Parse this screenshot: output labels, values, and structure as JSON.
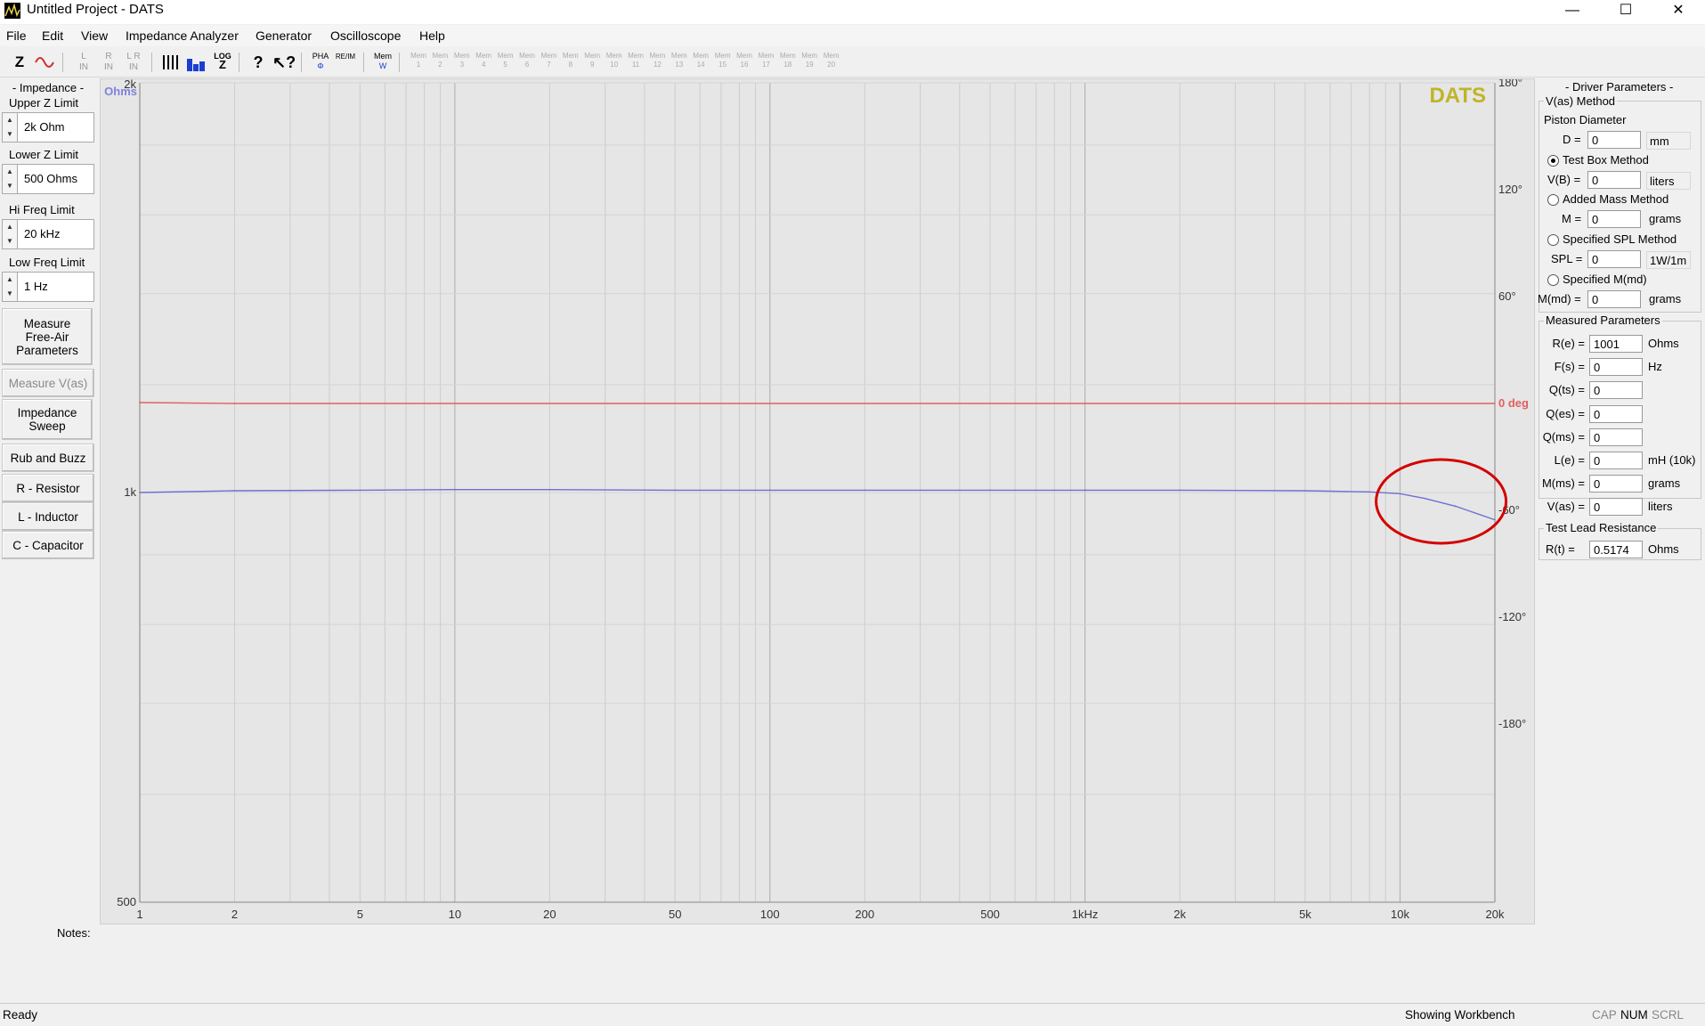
{
  "window": {
    "title": "Untitled Project - DATS",
    "minimize": "—",
    "maximize": "☐",
    "close": "✕"
  },
  "menu": [
    "File",
    "Edit",
    "View",
    "Impedance Analyzer",
    "Generator",
    "Oscilloscope",
    "Help"
  ],
  "toolbar": {
    "z_label": "Z",
    "log_label": "LOG",
    "pha_label": "PHA",
    "re_im_label": "RE/IM",
    "mem_label": "Mem",
    "mem_slots": [
      "1",
      "2",
      "3",
      "4",
      "5",
      "6",
      "7",
      "8",
      "9",
      "10",
      "11",
      "12",
      "13",
      "14",
      "15",
      "16",
      "17",
      "18",
      "19",
      "20"
    ]
  },
  "left_panel": {
    "header": "- Impedance -",
    "upper_z_label": "Upper Z Limit",
    "upper_z_value": "2k Ohm",
    "lower_z_label": "Lower Z Limit",
    "lower_z_value": "500 Ohms",
    "hi_freq_label": "Hi Freq Limit",
    "hi_freq_value": "20 kHz",
    "low_freq_label": "Low Freq Limit",
    "low_freq_value": "1 Hz",
    "buttons": {
      "measure_free_air": "Measure Free-Air Parameters",
      "measure_vas": "Measure V(as)",
      "impedance_sweep": "Impedance Sweep",
      "rub_and_buzz": "Rub and Buzz",
      "r_resistor": "R - Resistor",
      "l_inductor": "L - Inductor",
      "c_capacitor": "C - Capacitor"
    }
  },
  "chart_data": {
    "type": "line",
    "watermark": "DATS",
    "x_scale": "log",
    "xlim": [
      1,
      20000
    ],
    "x_ticks": [
      1,
      2,
      5,
      10,
      20,
      50,
      100,
      200,
      500,
      1000,
      2000,
      5000,
      10000,
      20000
    ],
    "x_tick_labels": [
      "1",
      "2",
      "5",
      "10",
      "20",
      "50",
      "100",
      "200",
      "500",
      "1kHz",
      "2k",
      "5k",
      "10k",
      "20k"
    ],
    "y_left_scale": "log",
    "y_left_unit": "Ohms",
    "ylim_left": [
      500,
      2000
    ],
    "y_left_tick_labels": [
      "2k",
      "1k",
      "500"
    ],
    "y_left_ticks": [
      2000,
      1000,
      500
    ],
    "y_right_ticks": [
      180,
      120,
      60,
      0,
      -60,
      -120,
      -180
    ],
    "y_right_tick_labels": [
      "180°",
      "120°",
      "60°",
      "0 deg",
      "-60°",
      "-120°",
      "-180°"
    ],
    "ylim_right": [
      -280,
      180
    ],
    "grid": true,
    "series": [
      {
        "axis": "left",
        "color": "#6f6fd2",
        "x": [
          1,
          2,
          5,
          10,
          20,
          50,
          100,
          200,
          500,
          1000,
          2000,
          5000,
          8000,
          10000,
          12000,
          15000,
          20000
        ],
        "y": [
          1000,
          1003,
          1004,
          1005,
          1005,
          1004,
          1004,
          1004,
          1004,
          1004,
          1004,
          1003,
          1001,
          998,
          990,
          977,
          955
        ]
      },
      {
        "axis": "right",
        "color": "#e06060",
        "x": [
          1,
          2,
          5,
          10,
          100,
          1000,
          10000,
          20000
        ],
        "y": [
          0.5,
          0,
          0,
          0,
          0,
          0,
          0,
          0
        ]
      }
    ],
    "annotation_color": "#d40000"
  },
  "right_panel": {
    "header": "- Driver Parameters -",
    "vas_method_label": "V(as) Method",
    "piston_diameter_label": "Piston Diameter",
    "d_label": "D =",
    "d_value": "0",
    "d_unit": "mm",
    "test_box_label": "Test Box Method",
    "vb_label": "V(B) =",
    "vb_value": "0",
    "vb_unit": "liters",
    "added_mass_label": "Added Mass Method",
    "m_label": "M =",
    "m_value": "0",
    "m_unit": "grams",
    "spl_method_label": "Specified SPL Method",
    "spl_label": "SPL =",
    "spl_value": "0",
    "spl_unit": "1W/1m",
    "mmd_method_label": "Specified M(md)",
    "mmd_label": "M(md) =",
    "mmd_value": "0",
    "mmd_unit": "grams",
    "measured_label": "Measured Parameters",
    "measured": [
      {
        "label": "R(e) =",
        "value": "1001",
        "unit": "Ohms"
      },
      {
        "label": "F(s) =",
        "value": "0",
        "unit": "Hz"
      },
      {
        "label": "Q(ts) =",
        "value": "0",
        "unit": ""
      },
      {
        "label": "Q(es) =",
        "value": "0",
        "unit": ""
      },
      {
        "label": "Q(ms) =",
        "value": "0",
        "unit": ""
      },
      {
        "label": "L(e) =",
        "value": "0",
        "unit": "mH (10k)"
      },
      {
        "label": "M(ms) =",
        "value": "0",
        "unit": "grams"
      },
      {
        "label": "V(as) =",
        "value": "0",
        "unit": "liters"
      }
    ],
    "test_lead_label": "Test Lead Resistance",
    "rt_label": "R(t) =",
    "rt_value": "0.5174",
    "rt_unit": "Ohms"
  },
  "notes_label": "Notes:",
  "status": {
    "left": "Ready",
    "workbench": "Showing Workbench",
    "cap": "CAP",
    "num": "NUM",
    "scrl": "SCRL"
  }
}
